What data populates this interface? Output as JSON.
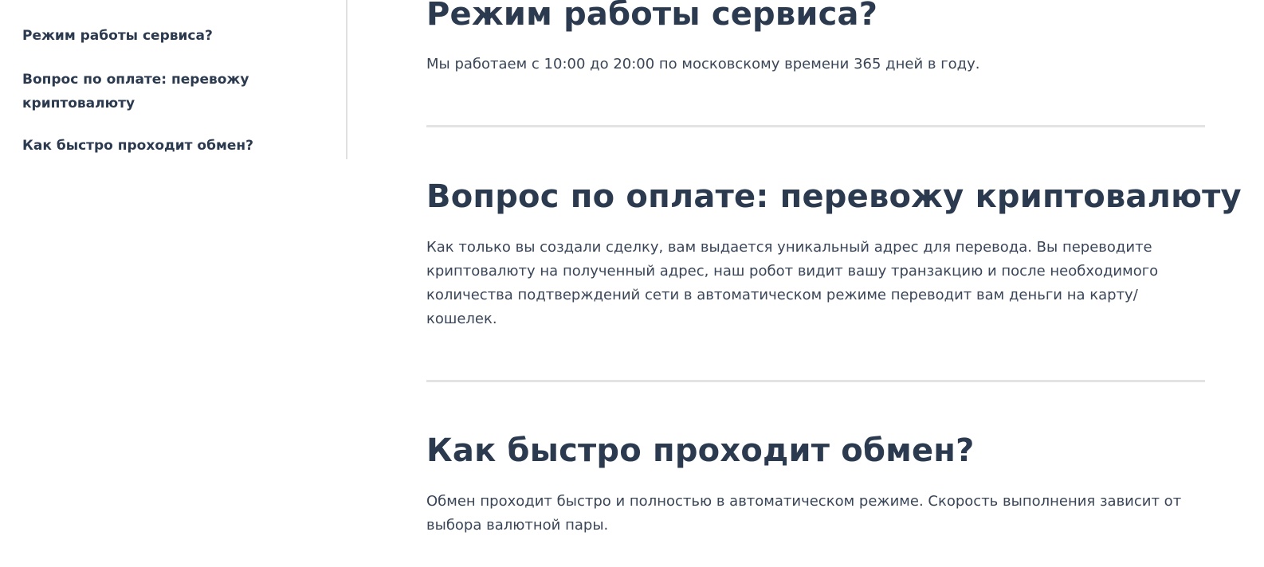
{
  "nav": {
    "items": [
      {
        "label": "Режим работы сервиса?"
      },
      {
        "label": "Вопрос по оплате: перевожу криптовалюту"
      },
      {
        "label": "Как быстро проходит обмен?"
      }
    ]
  },
  "sections": [
    {
      "title": "Режим работы сервиса?",
      "text": "Мы работаем с 10:00 до 20:00 по московскому времени 365 дней в году."
    },
    {
      "title": "Вопрос по оплате: перевожу криптовалюту",
      "text": "Как только вы создали сделку, вам выдается уникальный адрес для перевода. Вы переводите криптовалюту на полученный адрес, наш робот видит вашу транзакцию и после необходимого количества подтверждений сети в автоматическом режиме переводит вам деньги на карту/ кошелек."
    },
    {
      "title": "Как быстро проходит обмен?",
      "text": "Обмен проходит быстро и полностью в автоматическом режиме. Скорость выполнения зависит от выбора валютной пары."
    }
  ]
}
